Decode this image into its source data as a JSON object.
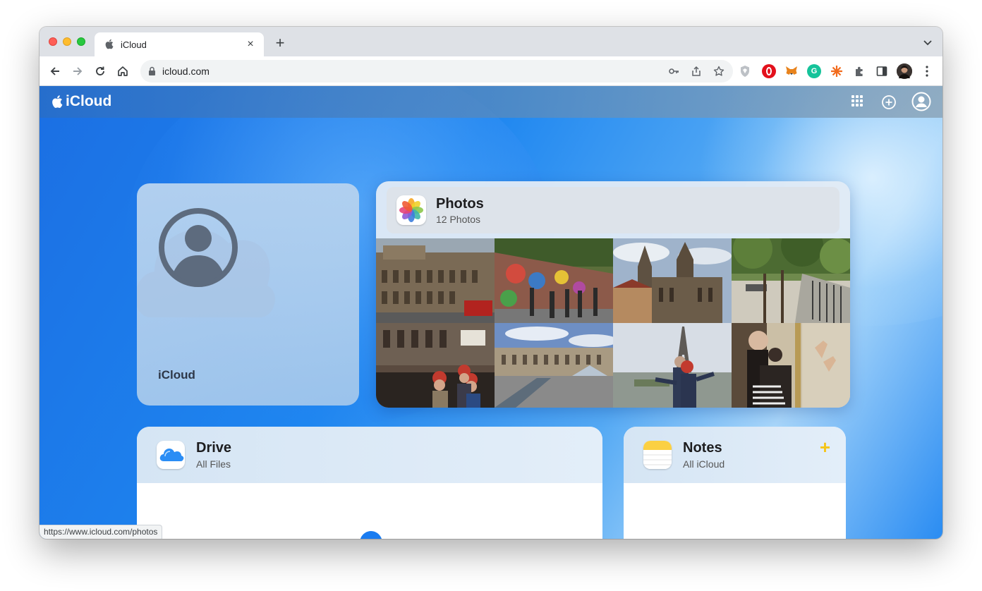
{
  "browser": {
    "tab": {
      "title": "iCloud",
      "favicon": "apple-icon"
    },
    "new_tab_label": "+",
    "url": "icloud.com",
    "status_url": "https://www.icloud.com/photos",
    "toolbar_icons": [
      "back-icon",
      "forward-icon",
      "reload-icon",
      "home-icon"
    ],
    "omnibox_icons": [
      "key-icon",
      "share-icon",
      "star-icon"
    ],
    "extensions": [
      "shield-extension-icon",
      "opera-extension-icon",
      "metamask-extension-icon",
      "grammarly-extension-icon",
      "sparkle-extension-icon",
      "puzzle-icon",
      "side-panel-icon",
      "profile-avatar",
      "kebab-menu-icon"
    ]
  },
  "app": {
    "brand": "iCloud",
    "header_icons": [
      "app-grid-icon",
      "add-icon",
      "account-icon"
    ]
  },
  "account_card": {
    "label": "iCloud"
  },
  "photos_card": {
    "title": "Photos",
    "subtitle": "12 Photos",
    "thumbnail_count": 8
  },
  "drive_card": {
    "title": "Drive",
    "subtitle": "All Files"
  },
  "notes_card": {
    "title": "Notes",
    "subtitle": "All iCloud",
    "add_label": "+"
  },
  "colors": {
    "page_blue": "#1e86f0",
    "accent_yellow": "#f5c518",
    "drive_blue": "#1a7cf0"
  }
}
